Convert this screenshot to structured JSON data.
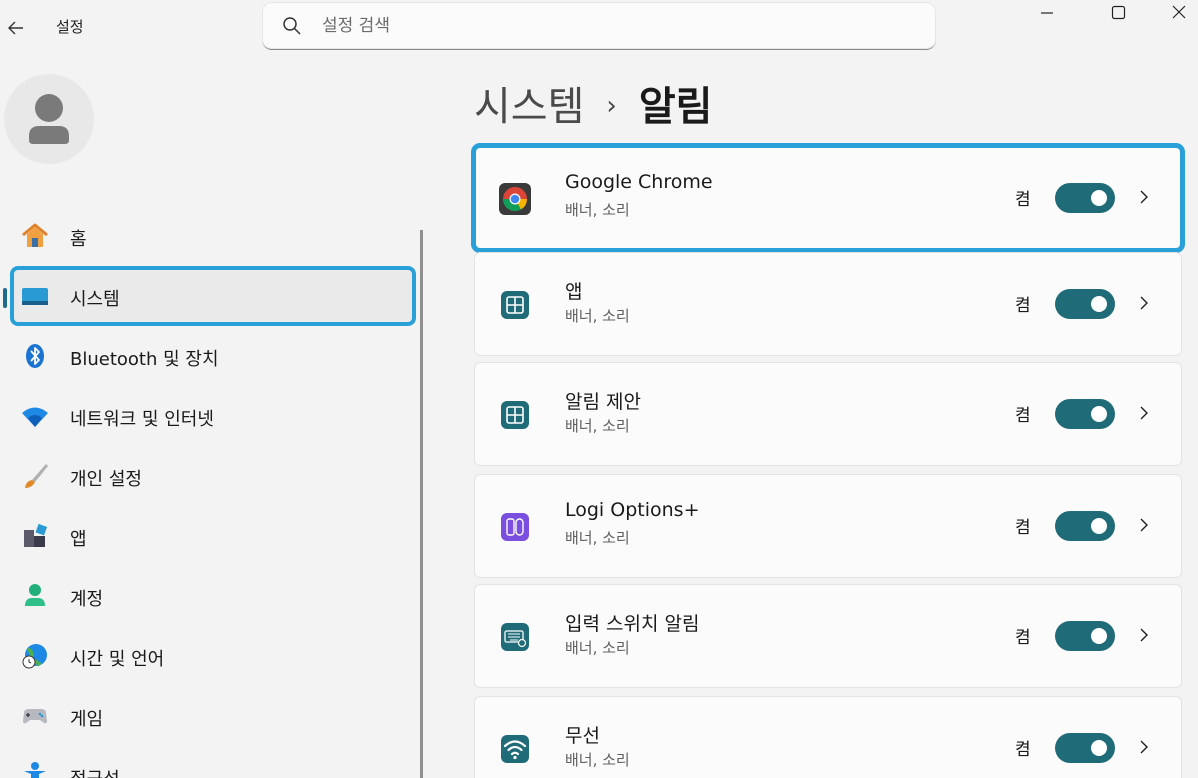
{
  "app": {
    "title": "설정",
    "search_placeholder": "설정 검색"
  },
  "sidebar": {
    "items": [
      {
        "label": "홈",
        "icon": "home-icon"
      },
      {
        "label": "시스템",
        "icon": "system-icon",
        "selected": true
      },
      {
        "label": "Bluetooth 및 장치",
        "icon": "bluetooth-icon"
      },
      {
        "label": "네트워크 및 인터넷",
        "icon": "wifi-icon"
      },
      {
        "label": "개인 설정",
        "icon": "brush-icon"
      },
      {
        "label": "앱",
        "icon": "apps-icon"
      },
      {
        "label": "계정",
        "icon": "account-icon"
      },
      {
        "label": "시간 및 언어",
        "icon": "globe-clock-icon"
      },
      {
        "label": "게임",
        "icon": "gamepad-icon"
      },
      {
        "label": "접근성",
        "icon": "accessibility-icon"
      }
    ]
  },
  "breadcrumb": {
    "parent": "시스템",
    "separator": "›",
    "current": "알림"
  },
  "notifications": [
    {
      "name": "Google Chrome",
      "sub": "배너, 소리",
      "state": "켬",
      "on": true,
      "icon": "chrome-icon"
    },
    {
      "name": "앱",
      "sub": "배너, 소리",
      "state": "켬",
      "on": true,
      "icon": "app-tile-icon"
    },
    {
      "name": "알림 제안",
      "sub": "배너, 소리",
      "state": "켬",
      "on": true,
      "icon": "app-tile-icon"
    },
    {
      "name": "Logi Options+",
      "sub": "배너, 소리",
      "state": "켬",
      "on": true,
      "icon": "logi-icon"
    },
    {
      "name": "입력 스위치 알림",
      "sub": "배너, 소리",
      "state": "켬",
      "on": true,
      "icon": "keyboard-icon"
    },
    {
      "name": "무선",
      "sub": "배너, 소리",
      "state": "켬",
      "on": true,
      "icon": "wireless-icon"
    }
  ],
  "colors": {
    "accent": "#1f6b78",
    "highlight": "#2aa0d8"
  }
}
